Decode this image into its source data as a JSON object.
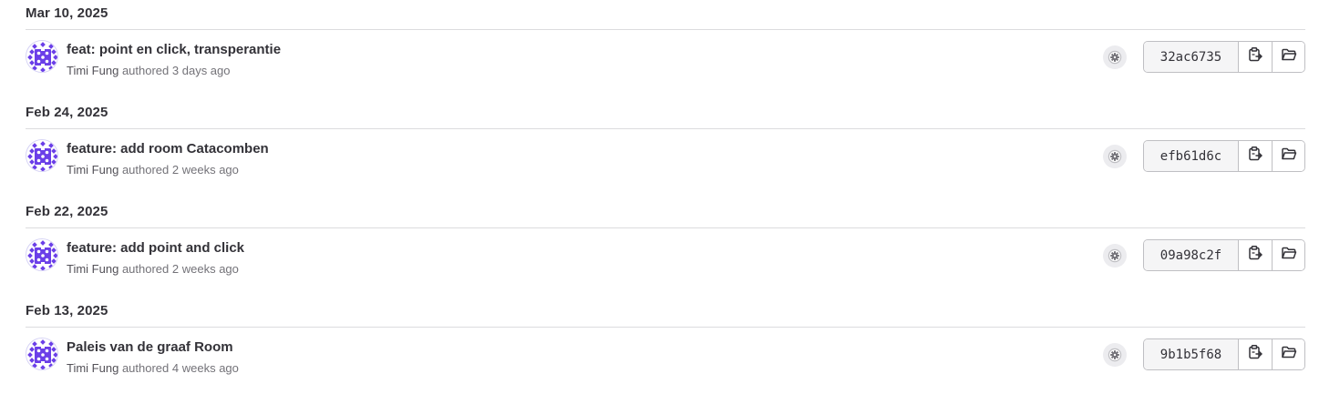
{
  "commit_groups": [
    {
      "date": "Mar 10, 2025",
      "commit": {
        "title": "feat: point en click, transperantie",
        "author": "Timi Fung",
        "authored_label": "authored",
        "time_ago": "3 days ago",
        "sha": "32ac6735",
        "pipeline_icon": "pipeline-status-icon",
        "copy_icon": "clipboard-icon",
        "browse_icon": "folder-open-icon"
      }
    },
    {
      "date": "Feb 24, 2025",
      "commit": {
        "title": "feature: add room Catacomben",
        "author": "Timi Fung",
        "authored_label": "authored",
        "time_ago": "2 weeks ago",
        "sha": "efb61d6c",
        "pipeline_icon": "pipeline-status-icon",
        "copy_icon": "clipboard-icon",
        "browse_icon": "folder-open-icon"
      }
    },
    {
      "date": "Feb 22, 2025",
      "commit": {
        "title": "feature: add point and click",
        "author": "Timi Fung",
        "authored_label": "authored",
        "time_ago": "2 weeks ago",
        "sha": "09a98c2f",
        "pipeline_icon": "pipeline-status-icon",
        "copy_icon": "clipboard-icon",
        "browse_icon": "folder-open-icon"
      }
    },
    {
      "date": "Feb 13, 2025",
      "commit": {
        "title": "Paleis van de graaf Room",
        "author": "Timi Fung",
        "authored_label": "authored",
        "time_ago": "4 weeks ago",
        "sha": "9b1b5f68",
        "pipeline_icon": "pipeline-status-icon",
        "copy_icon": "clipboard-icon",
        "browse_icon": "folder-open-icon"
      }
    }
  ],
  "colors": {
    "avatar_accent": "#6b3fe8",
    "text_primary": "#333238",
    "text_secondary": "#737278",
    "divider": "#dcdcde",
    "pipeline_neutral": "#ececef"
  }
}
